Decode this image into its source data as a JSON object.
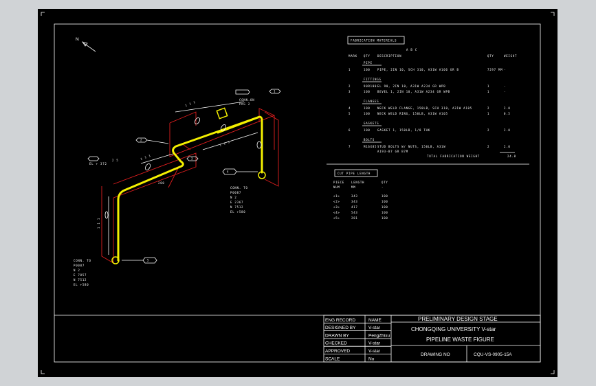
{
  "north_label": "N",
  "tags": {
    "node1": "1",
    "node2": "2",
    "node3": "3",
    "node4": "4",
    "node5": "5"
  },
  "connections": {
    "top": "CONN.ON\nPKG 2",
    "right": "CONN. TO\nP0087\nN 2\nE 2367\nN 7512\nEL +580",
    "bottom": "CONN. TO\nP0087\nN 2\nE 7857\nN 7512\nEL +580"
  },
  "misc_labels": {
    "el_left": "EL + 372",
    "dim_left": "2 5",
    "elbow_note": "200",
    "dim_top1": "1 1 1",
    "dim_mid1": "1 1 1",
    "dim_mid2": "1 1 1",
    "dim_vert": "1 1 1"
  },
  "material_list": {
    "title": "FABRICATION MATERIALS",
    "col_headers": [
      "MARK",
      "QTY",
      "DESCRIPTION",
      "QTY",
      "WEIGHT"
    ],
    "sub_header": "A B C",
    "groups": [
      {
        "name": "PIPE",
        "rows": [
          {
            "mark": "1",
            "qty": "100",
            "desc": "PIPE, 2IN 10, SCH 310, A31W A106 GR B",
            "qty2": "7297 MM",
            "weight": "-"
          }
        ]
      },
      {
        "name": "FITTINGS",
        "rows": [
          {
            "mark": "2",
            "qty": "90R100",
            "desc": "EL 90, 2IN 10, A31W A234 GR WPB",
            "qty2": "1",
            "weight": "-"
          },
          {
            "mark": "3",
            "qty": "100",
            "desc": "BEVEL 1, 2IN 10, A31W A234 GR WPB",
            "qty2": "1",
            "weight": "-"
          }
        ]
      },
      {
        "name": "FLANGES",
        "rows": [
          {
            "mark": "4",
            "qty": "100",
            "desc": "NECK WELD FLANGE, 150LB, SCH 310, A31W A105",
            "qty2": "2",
            "weight": "2.0"
          },
          {
            "mark": "5",
            "qty": "100",
            "desc": "NECK WELD RING, 150LB, A31W A105",
            "qty2": "1",
            "weight": "0.5"
          }
        ]
      },
      {
        "name": "GASKETS",
        "rows": [
          {
            "mark": "6",
            "qty": "100",
            "desc": "GASKET 1, 150LB, 1/8 THK",
            "qty2": "2",
            "weight": "2.0"
          }
        ]
      },
      {
        "name": "BOLTS",
        "rows": [
          {
            "mark": "7",
            "qty": "M16X85",
            "desc": "STUD BOLTS W/ NUTS, 150LB, A31W\nA193-B7 GR B7M",
            "qty2": "2",
            "weight": "2.0"
          }
        ]
      }
    ],
    "total_label": "TOTAL FABRICATION WEIGHT",
    "total_value": "24.8"
  },
  "cut_pipe": {
    "title": "CUT PIPE LENGTH",
    "col_headers": [
      [
        "PIECE",
        "NUM"
      ],
      [
        "LENGTH",
        "MM"
      ],
      [
        "QTY",
        "-"
      ]
    ],
    "rows": [
      [
        "<1>",
        "343",
        "100"
      ],
      [
        "<2>",
        "343",
        "100"
      ],
      [
        "<3>",
        "417",
        "100"
      ],
      [
        "<4>",
        "543",
        "100"
      ],
      [
        "<5>",
        "281",
        "100"
      ]
    ]
  },
  "title_block": {
    "rows": [
      {
        "label": "ENG RECORD",
        "value": "NAME"
      },
      {
        "label": "DESIGNED BY",
        "value": "V-star"
      },
      {
        "label": "DRAWN BY",
        "value": "PengZhixu"
      },
      {
        "label": "CHECKED",
        "value": "V-star"
      },
      {
        "label": "APPROVED",
        "value": "V-star"
      },
      {
        "label": "SCALE",
        "value": "No"
      }
    ],
    "stage": "PRELIMINARY DESIGN STAGE",
    "university": "CHONGQING UNIVERSITY V-star",
    "figure_title": "PIPELINE WASTE FIGURE",
    "drawing_no_label": "DRAWING NO",
    "drawing_no": "CQU-VS-0905-15A"
  },
  "colors": {
    "pipe": "#f4f000",
    "support": "#e01e1e",
    "line": "#ffffff",
    "background": "#000000",
    "outer": "#d0d3d6"
  }
}
